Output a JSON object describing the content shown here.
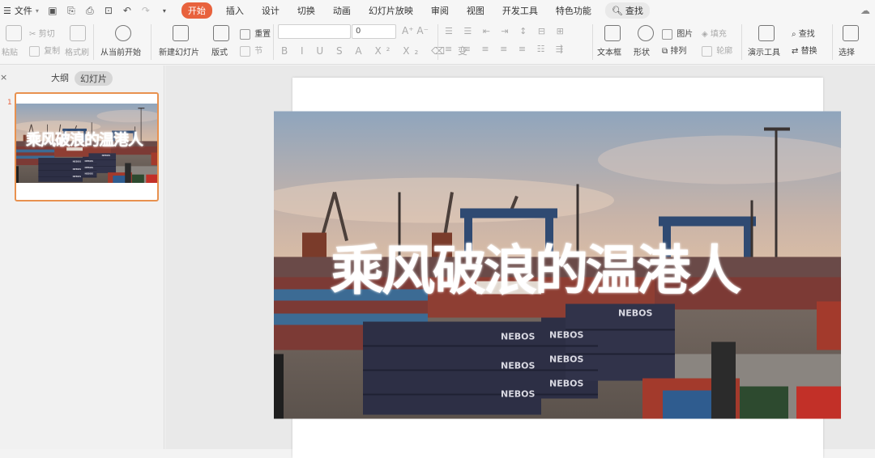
{
  "menubar": {
    "file_label": "文件",
    "tabs": [
      "开始",
      "插入",
      "设计",
      "切换",
      "动画",
      "幻灯片放映",
      "审阅",
      "视图",
      "开发工具",
      "特色功能"
    ],
    "active_tab": "开始",
    "search_label": "查找"
  },
  "ribbon": {
    "paste": "粘贴",
    "cut": "剪切",
    "copy": "复制",
    "format_painter": "格式刷",
    "play_from_current": "从当前开始",
    "new_slide": "新建幻灯片",
    "layout": "版式",
    "section": "节",
    "reset": "重置",
    "font_size_value": "0",
    "textbox": "文本框",
    "shape": "形状",
    "picture": "图片",
    "fill": "填充",
    "arrange": "排列",
    "outline": "轮廓",
    "presentation_tools": "演示工具",
    "find": "查找",
    "replace": "替换",
    "select": "选择"
  },
  "left_panel": {
    "close_label": "×",
    "tab_outline": "大纲",
    "tab_slides": "幻灯片",
    "slide_number": "1"
  },
  "slide": {
    "title": "乘风破浪的温港人"
  },
  "colors": {
    "accent": "#e8623d",
    "thumb_border": "#e8914f"
  }
}
